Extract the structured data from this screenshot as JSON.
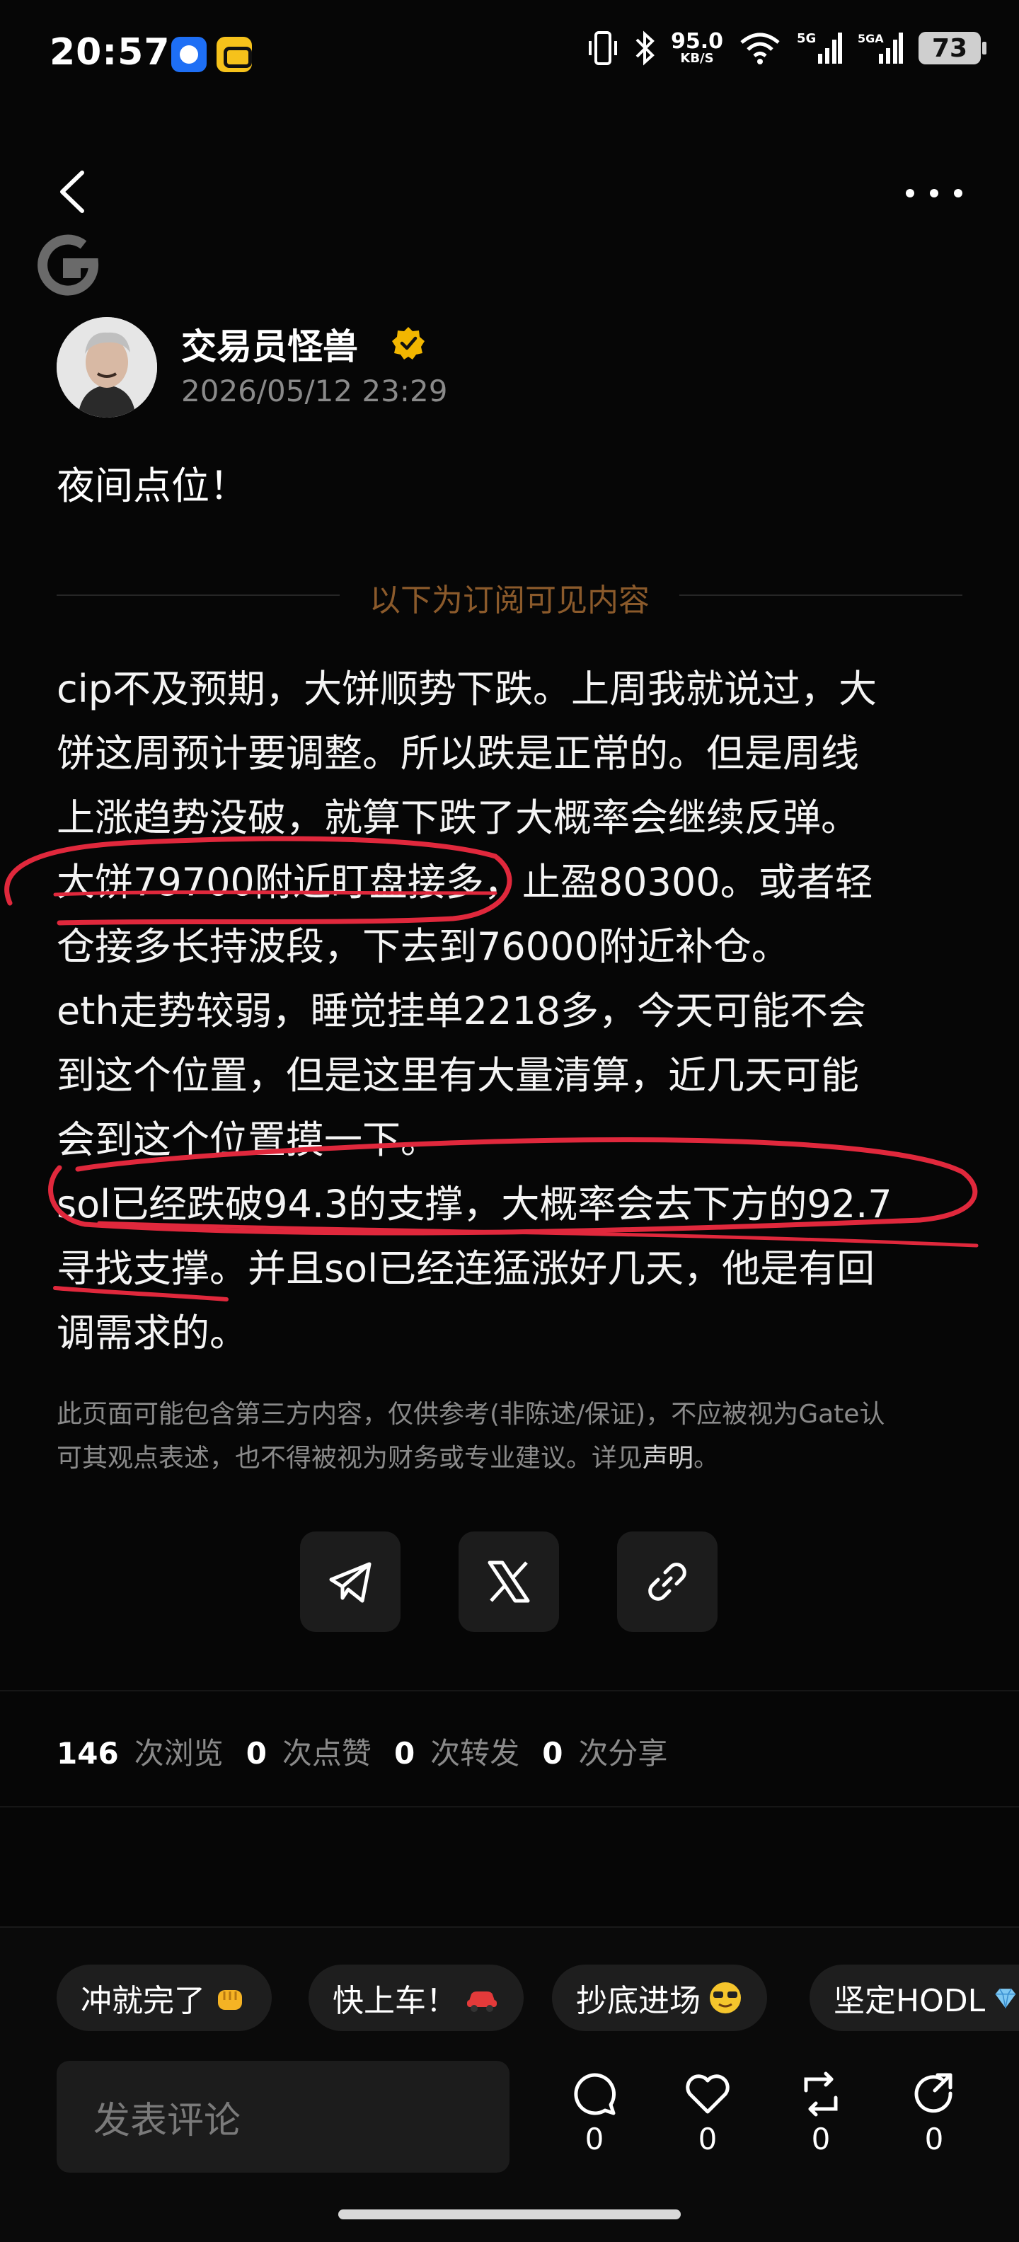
{
  "status_bar": {
    "time": "20:57",
    "net_speed_value": "95.0",
    "net_speed_unit": "KB/S",
    "battery": "73"
  },
  "author": {
    "name": "交易员怪兽",
    "post_time": "2026/05/12 23:29"
  },
  "post": {
    "intro": "夜间点位！",
    "subscriber_divider": "以下为订阅可见内容",
    "lines": [
      "cip不及预期，大饼顺势下跌。上周我就说过，大",
      "饼这周预计要调整。所以跌是正常的。但是周线",
      "上涨趋势没破，就算下跌了大概率会继续反弹。",
      "大饼79700附近盯盘接多，止盈80300。或者轻",
      "仓接多长持波段，下去到76000附近补仓。",
      "eth走势较弱，睡觉挂单2218多，今天可能不会",
      "到这个位置，但是这里有大量清算，近几天可能",
      "会到这个位置摸一下。",
      "sol已经跌破94.3的支撑，大概率会去下方的92.7",
      "寻找支撑。并且sol已经连猛涨好几天，他是有回",
      "调需求的。"
    ],
    "disclaimer_line1": "此页面可能包含第三方内容，仅供参考(非陈述/保证)，不应被视为Gate认",
    "disclaimer_line2": "可其观点表述，也不得被视为财务或专业建议。详见",
    "disclaimer_link": "声明",
    "disclaimer_end": "。"
  },
  "stats": {
    "views": "146",
    "views_label": "次浏览",
    "likes": "0",
    "likes_label": "次点赞",
    "reposts": "0",
    "reposts_label": "次转发",
    "shares": "0",
    "shares_label": "次分享"
  },
  "quick_reactions": [
    "冲就完了",
    "快上车！",
    "抄底进场",
    "坚定HODL"
  ],
  "comment_placeholder": "发表评论",
  "actions": {
    "comment_count": "0",
    "like_count": "0",
    "repost_count": "0",
    "share_count": "0"
  },
  "colors": {
    "background": "#060606",
    "muted_text": "#8a8a8a",
    "divider_text": "#8b5a2b",
    "scribble": "#e0283c",
    "verified": "#f2b600"
  }
}
